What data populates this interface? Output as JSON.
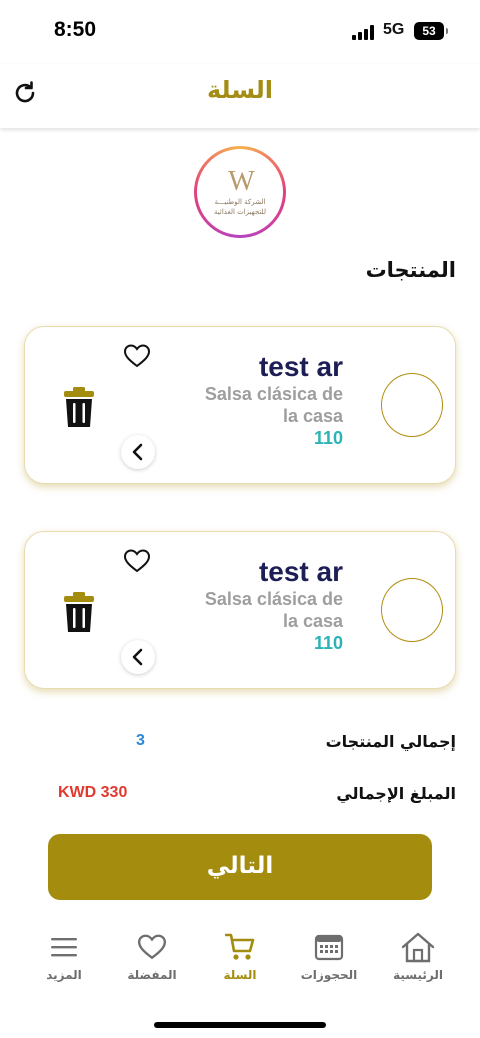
{
  "status_bar": {
    "time": "8:50",
    "network": "5G",
    "battery": "53"
  },
  "header": {
    "title": "السلة"
  },
  "logo": {
    "mark": "W",
    "text_line1": "الشركة الوطنيـــة",
    "text_line2": "للتجهيزات الغذائية"
  },
  "section": {
    "title": "المنتجات"
  },
  "products": [
    {
      "name": "test ar",
      "desc_line1": "Salsa clásica de",
      "desc_line2": "la casa",
      "price": "110"
    },
    {
      "name": "test ar",
      "desc_line1": "Salsa clásica de",
      "desc_line2": "la casa",
      "price": "110"
    }
  ],
  "summary": {
    "count_label": "إجمالي المنتجات",
    "count_value": "3",
    "total_label": "المبلغ الإجمالي",
    "total_value": "KWD 330"
  },
  "next_button": {
    "label": "التالي"
  },
  "tabbar": {
    "home": "الرئيسية",
    "bookings": "الحجوزات",
    "cart": "السلة",
    "favorites": "المفضلة",
    "more": "المزيد"
  },
  "colors": {
    "accent": "#a48d0e",
    "product_name": "#1d1e55",
    "price": "#2bb3b5",
    "count": "#2b88d8",
    "total": "#e03a2f"
  },
  "icons": [
    "refresh-icon",
    "heart-icon",
    "trash-icon",
    "chevron-left-icon",
    "home-icon",
    "calendar-icon",
    "cart-icon",
    "menu-icon"
  ]
}
